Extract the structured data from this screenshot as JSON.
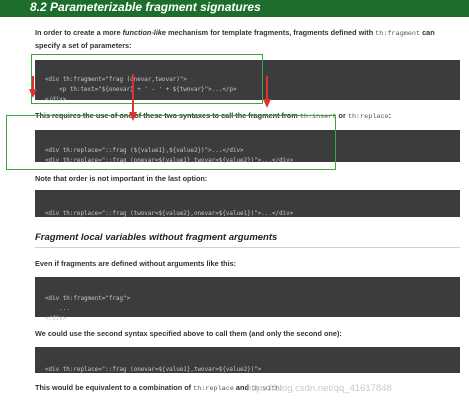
{
  "section_heading": "8.2 Parameterizable fragment signatures",
  "p1": {
    "line1_pre": "In order to create a more ",
    "line1_em": "function-like",
    "line1_post": " mechanism for template fragments, fragments defined with ",
    "line1_code": "th:fragment",
    "line1_end": " can",
    "line2": "specify a set of parameters:"
  },
  "code1": [
    "<div th:fragment=\"frag (onevar,twovar)\">",
    "    <p th:text=\"${onevar} + ' - ' + ${twovar}\">...</p>",
    "</div>"
  ],
  "p2": {
    "pre": "This requires the use of one of these two syntaxes to call the fragment from ",
    "code_a": "th:insert",
    "mid": " or ",
    "code_b": "th:replace",
    "end": ":"
  },
  "code2": [
    "<div th:replace=\"::frag (${value1},${value2})\">...</div>",
    "<div th:replace=\"::frag (onevar=${value1},twovar=${value2})\">...</div>"
  ],
  "p3": "Note that order is not important in the last option:",
  "code3": [
    "<div th:replace=\"::frag (twovar=${value2},onevar=${value1})\">...</div>"
  ],
  "subheading": "Fragment local variables without fragment arguments",
  "p4": "Even if fragments are defined without arguments like this:",
  "code4": [
    "<div th:fragment=\"frag\">",
    "    ...",
    "</div>"
  ],
  "p5": "We could use the second syntax specified above to call them (and only the second one):",
  "code5": [
    "<div th:replace=\"::frag (onevar=${value1},twovar=${value2})\">"
  ],
  "p6": {
    "pre": "This would be equivalent to a combination of ",
    "code_a": "th:replace",
    "mid": " and ",
    "code_b": "th:with",
    "end": ":"
  },
  "watermark": "https://blog.csdn.net/qq_41617848",
  "colors": {
    "header": "#1d6e2c",
    "code_bg": "#3a3c3d",
    "highlight_box": "#3aa83a",
    "arrows": "#e23030"
  }
}
